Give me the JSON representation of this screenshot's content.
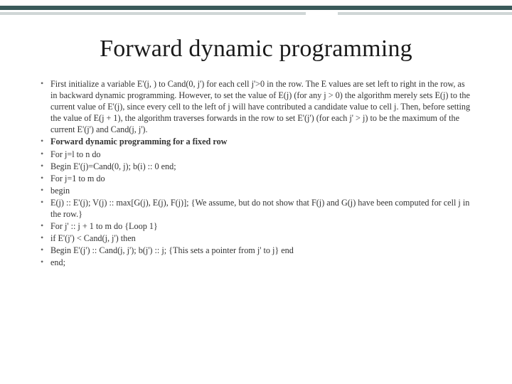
{
  "title": "Forward dynamic programming",
  "bullets": [
    {
      "text": "First initialize a variable E'(j, ) to Cand(0, j') for each cell j'>0 in the row. The E values are set left to right in the row, as in backward dynamic programming. However, to set the value of E(j) (for any j > 0) the algorithm merely sets E(j) to the current value of E'(j), since every cell to the left of j will have contributed a candidate value to cell j. Then, before setting the value of E(j + 1), the algorithm traverses forwards in the row to set E'(j') (for each j' > j) to be the maximum of the current E'(j') and Cand(j, j').",
      "bold": false
    },
    {
      "text": "Forward dynamic programming for a fixed row",
      "bold": true
    },
    {
      "text": "For j=l to n do",
      "bold": false
    },
    {
      "text": "Begin E'(j)=Cand(0, j); b(i) :: 0 end;",
      "bold": false
    },
    {
      "text": "For j=1 to m do",
      "bold": false
    },
    {
      "text": "begin",
      "bold": false
    },
    {
      "text": "E(j) :: E'(j); V(j) :: max[G(j), E(j), F(j)]; {We assume, but do not show that F(j) and G(j) have been computed for cell j in the row.}",
      "bold": false
    },
    {
      "text": "For j' :: j + 1 to m do {Loop 1}",
      "bold": false
    },
    {
      "text": "if E'(j') < Cand(j, j') then",
      "bold": false
    },
    {
      "text": "Begin E'(j') :: Cand(j, j'); b(j') :: j; {This sets a pointer from j' to j} end",
      "bold": false
    },
    {
      "text": "end;",
      "bold": false
    }
  ]
}
